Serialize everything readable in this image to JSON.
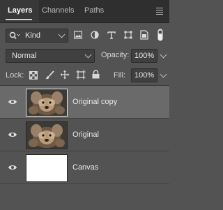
{
  "tabs": [
    {
      "label": "Layers",
      "active": true
    },
    {
      "label": "Channels",
      "active": false
    },
    {
      "label": "Paths",
      "active": false
    }
  ],
  "filter": {
    "kind_label": "Kind",
    "icons": [
      "search-icon",
      "image-filter-icon",
      "adjustment-filter-icon",
      "type-filter-icon",
      "shape-filter-icon",
      "smart-object-filter-icon",
      "filter-toggle-icon"
    ]
  },
  "blend": {
    "mode": "Normal",
    "opacity_label": "Opacity:",
    "opacity_value": "100%"
  },
  "lock": {
    "label": "Lock:",
    "icons": [
      "lock-transparent-pixels-icon",
      "lock-image-pixels-icon",
      "lock-position-icon",
      "lock-artboard-icon",
      "lock-all-icon"
    ],
    "fill_label": "Fill:",
    "fill_value": "100%"
  },
  "layers": [
    {
      "name": "Original copy",
      "selected": true,
      "visible": true,
      "thumb": "photo"
    },
    {
      "name": "Original",
      "selected": false,
      "visible": true,
      "thumb": "photo"
    },
    {
      "name": "Canvas",
      "selected": false,
      "visible": true,
      "thumb": "white"
    }
  ],
  "colors": {
    "panel_bg": "#535353",
    "tabbar_bg": "#2f2f2f",
    "selected_row": "#6a6a6a"
  }
}
